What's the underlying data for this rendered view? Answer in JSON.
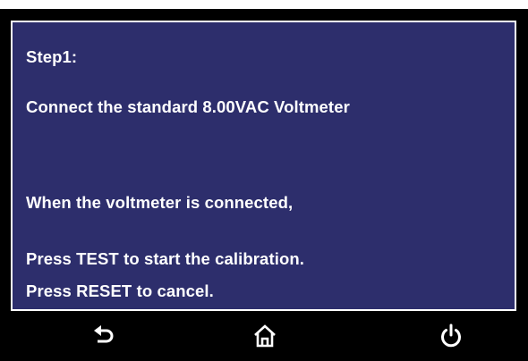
{
  "message": {
    "step": "Step1:",
    "instruction": "Connect the standard 8.00VAC Voltmeter",
    "condition": "When the voltmeter is connected,",
    "test_prompt": "Press TEST to start the calibration.",
    "reset_prompt": "Press RESET to cancel."
  },
  "navbar": {
    "buttons": [
      {
        "name": "back",
        "icon": "back-arrow-icon"
      },
      {
        "name": "home",
        "icon": "home-icon"
      },
      {
        "name": "power",
        "icon": "power-icon"
      }
    ]
  },
  "colors": {
    "panel_background": "#2d2e6c",
    "panel_border": "#ffffff",
    "text": "#ffffff",
    "navbar_background": "#000000"
  }
}
